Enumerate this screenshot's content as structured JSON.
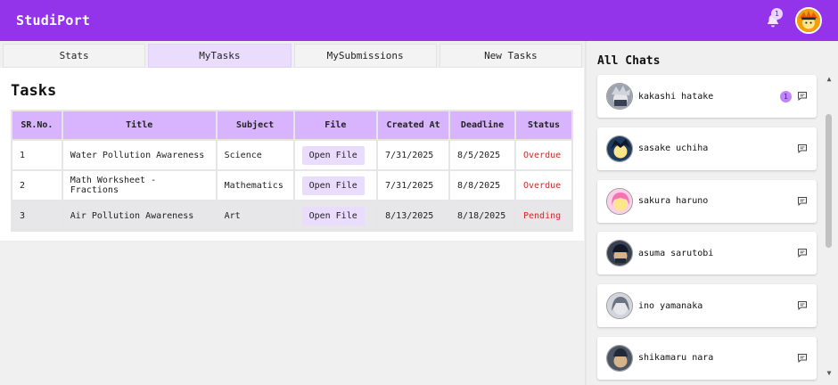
{
  "app": {
    "title": "StudiPort"
  },
  "notifications": {
    "count": "1"
  },
  "tabs": [
    {
      "label": "Stats",
      "active": false
    },
    {
      "label": "MyTasks",
      "active": true
    },
    {
      "label": "MySubmissions",
      "active": false
    },
    {
      "label": "New Tasks",
      "active": false
    }
  ],
  "tasks": {
    "heading": "Tasks",
    "columns": [
      "SR.No.",
      "Title",
      "Subject",
      "File",
      "Created At",
      "Deadline",
      "Status"
    ],
    "rows": [
      {
        "sr": "1",
        "title": "Water Pollution Awareness",
        "subject": "Science",
        "file": "Open File",
        "created": "7/31/2025",
        "deadline": "8/5/2025",
        "status": "Overdue"
      },
      {
        "sr": "2",
        "title": "Math Worksheet - Fractions",
        "subject": "Mathematics",
        "file": "Open File",
        "created": "7/31/2025",
        "deadline": "8/8/2025",
        "status": "Overdue"
      },
      {
        "sr": "3",
        "title": "Air Pollution Awareness",
        "subject": "Art",
        "file": "Open File",
        "created": "8/13/2025",
        "deadline": "8/18/2025",
        "status": "Pending"
      }
    ]
  },
  "chats": {
    "heading": "All Chats",
    "items": [
      {
        "name": "kakashi hatake",
        "unread": "1",
        "color": "#6b7280"
      },
      {
        "name": "sasake uchiha",
        "unread": "",
        "color": "#1e3a5f"
      },
      {
        "name": "sakura haruno",
        "unread": "",
        "color": "#f9a8d4"
      },
      {
        "name": "asuma sarutobi",
        "unread": "",
        "color": "#374151"
      },
      {
        "name": "ino yamanaka",
        "unread": "",
        "color": "#9ca3af"
      },
      {
        "name": "shikamaru nara",
        "unread": "",
        "color": "#4b5563"
      }
    ]
  },
  "colors": {
    "brand": "#9333ea",
    "header_cell": "#d8b4fe",
    "active_tab": "#eadcfd",
    "status": "#dc2626"
  }
}
